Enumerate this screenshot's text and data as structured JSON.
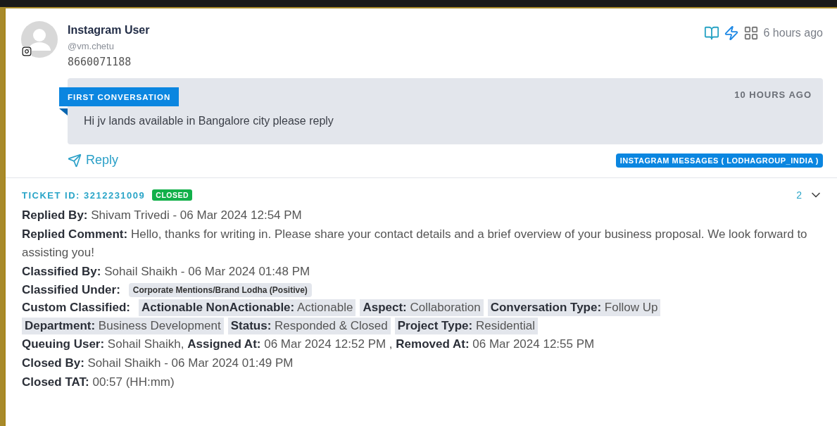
{
  "post": {
    "author": "Instagram User",
    "handle": "@vm.chetu",
    "time": "6 hours ago",
    "text": "8660071188"
  },
  "conversation": {
    "label": "FIRST CONVERSATION",
    "time": "10 HOURS AGO",
    "message": "Hi jv lands available in Bangalore city please reply"
  },
  "reply_link": "Reply",
  "source_badge": "INSTAGRAM MESSAGES ( LODHAGROUP_INDIA )",
  "ticket": {
    "id_label": "TICKET ID: 3212231009",
    "status": "CLOSED",
    "count": "2",
    "expanded": false,
    "lines": [
      {
        "kind": "text",
        "text": "**Replied By:** Shivam Trivedi - 06 Mar 2024 12:54 PM"
      },
      {
        "kind": "text",
        "text": "**Replied Comment:** Hello, thanks for writing in. Please share your contact details and a brief overview of your business proposal. We look forward to assisting you!"
      },
      {
        "kind": "text",
        "text": "**Classified By:** Sohail Shaikh - 06 Mar 2024 01:48 PM"
      },
      {
        "kind": "category",
        "label": "Classified Under:",
        "chips": [
          "Corporate Mentions/Brand Lodha (Positive)"
        ]
      },
      {
        "kind": "custom",
        "label": "Custom Classified:",
        "chips": [
          "**Actionable NonActionable:** Actionable",
          "**Aspect:** Collaboration",
          "**Conversation Type:** Follow Up",
          "**Department:** Business Development",
          "**Status:** Responded & Closed",
          "**Project Type:** Residential"
        ]
      },
      {
        "kind": "text",
        "text": "**Queuing User:** Sohail Shaikh, **Assigned At:** 06 Mar 2024 12:52 PM , **Removed At:** 06 Mar 2024 12:55 PM"
      },
      {
        "kind": "text",
        "text": "**Closed By:** Sohail Shaikh - 06 Mar 2024 01:49 PM"
      },
      {
        "kind": "text",
        "text": "**Closed TAT:** 00:57 (HH:mm)"
      }
    ]
  }
}
